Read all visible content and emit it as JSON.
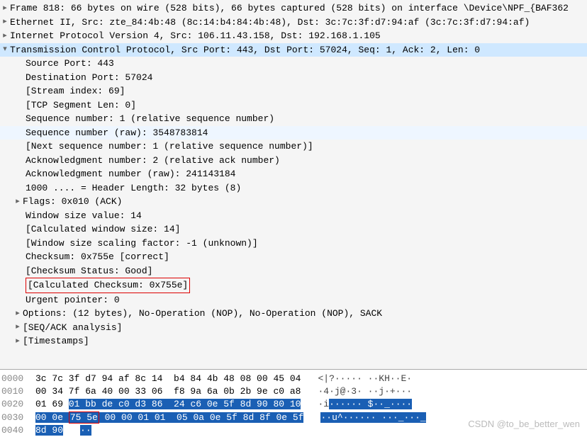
{
  "tree": {
    "frame": "Frame 818: 66 bytes on wire (528 bits), 66 bytes captured (528 bits) on interface \\Device\\NPF_{BAF362",
    "eth": "Ethernet II, Src: zte_84:4b:48 (8c:14:b4:84:4b:48), Dst: 3c:7c:3f:d7:94:af (3c:7c:3f:d7:94:af)",
    "ip": "Internet Protocol Version 4, Src: 106.11.43.158, Dst: 192.168.1.105",
    "tcp": "Transmission Control Protocol, Src Port: 443, Dst Port: 57024, Seq: 1, Ack: 2, Len: 0",
    "srcport": "Source Port: 443",
    "dstport": "Destination Port: 57024",
    "stream": "[Stream index: 69]",
    "seglen": "[TCP Segment Len: 0]",
    "seq": "Sequence number: 1    (relative sequence number)",
    "seq_raw": "Sequence number (raw): 3548783814",
    "nextseq": "[Next sequence number: 1    (relative sequence number)]",
    "ack": "Acknowledgment number: 2    (relative ack number)",
    "ack_raw": "Acknowledgment number (raw): 241143184",
    "hdrlen": "1000 .... = Header Length: 32 bytes (8)",
    "flags": "Flags: 0x010 (ACK)",
    "win": "Window size value: 14",
    "calcwin": "[Calculated window size: 14]",
    "winscale": "[Window size scaling factor: -1 (unknown)]",
    "checksum": "Checksum: 0x755e [correct]",
    "chk_status": "[Checksum Status: Good]",
    "calc_chk": "[Calculated Checksum: 0x755e]",
    "urgent": "Urgent pointer: 0",
    "options": "Options: (12 bytes), No-Operation (NOP), No-Operation (NOP), SACK",
    "seqack": "[SEQ/ACK analysis]",
    "timestamps": "[Timestamps]"
  },
  "hex": {
    "r0": {
      "off": "0000",
      "b": "3c 7c 3f d7 94 af 8c 14  b4 84 4b 48 08 00 45 04",
      "a": "<|?····· ··KH··E·"
    },
    "r1": {
      "off": "0010",
      "b": "00 34 7f 6a 40 00 33 06  f8 9a 6a 0b 2b 9e c0 a8",
      "a": "·4·j@·3· ··j·+···"
    },
    "r2": {
      "off": "0020",
      "b1": "01 69 ",
      "b2": "01 bb de c0 d3 86  24 c6 0e 5f 8d 90 80 10",
      "a1": "·i",
      "a2": "······ $··_····"
    },
    "r3": {
      "off": "0030",
      "b1": "00 0e ",
      "b2": "75 5e",
      "b3": " 00 00 01 01  05 0a 0e 5f 8d 8f 0e 5f",
      "a1": "··",
      "a2": "u^······ ···_···_"
    },
    "r4": {
      "off": "0040",
      "b": "8d 90",
      "a": "··"
    }
  },
  "watermark": "CSDN @to_be_better_wen"
}
